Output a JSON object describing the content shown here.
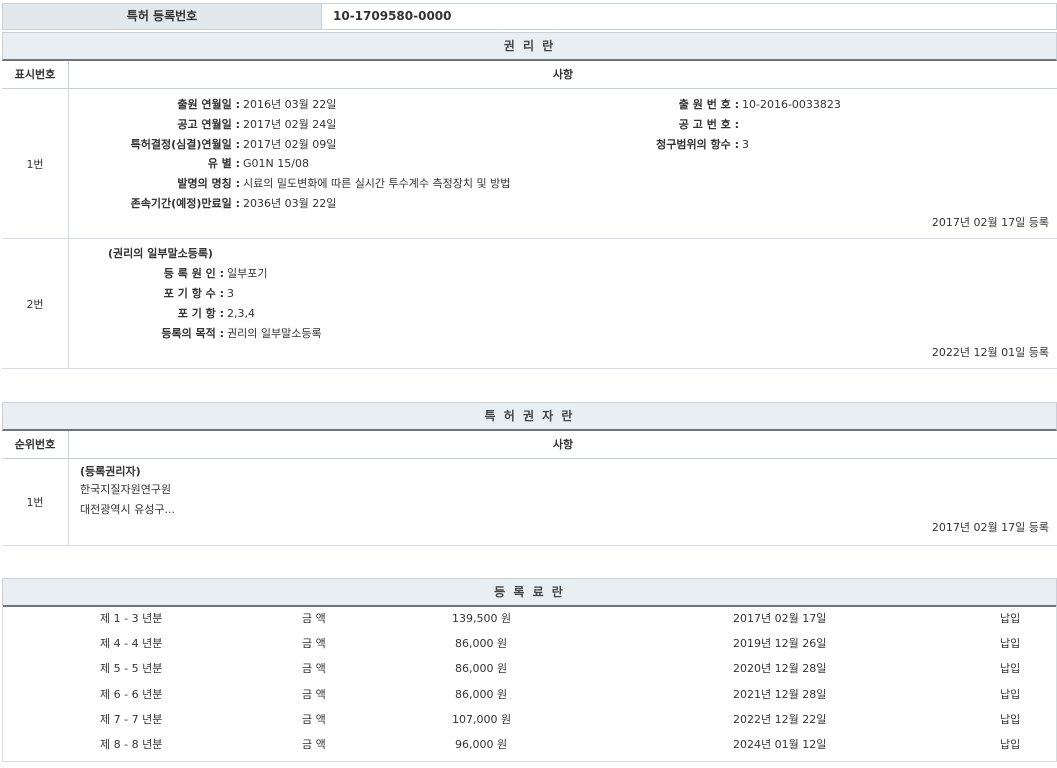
{
  "header": {
    "reg_label": "특허 등록번호",
    "reg_number": "10-1709580-0000"
  },
  "rights": {
    "title": "권 리 란",
    "col_num": "표시번호",
    "col_detail": "사항",
    "entries": [
      {
        "num": "1번",
        "left_fields": [
          {
            "key": "출원 연월일 :",
            "value": "2016년 03월 22일"
          },
          {
            "key": "공고 연월일 :",
            "value": "2017년 02월 24일"
          },
          {
            "key": "특허결정(심결)연월일 :",
            "value": "2017년 02월 09일"
          },
          {
            "key": "유 별 :",
            "value": "G01N 15/08"
          },
          {
            "key": "발명의 명칭 :",
            "value": "시료의 밀도변화에 따른 실시간 투수계수 측정장치 및 방법"
          },
          {
            "key": "존속기간(예정)만료일 :",
            "value": "2036년 03월 22일"
          }
        ],
        "right_fields": [
          {
            "key": "출 원 번 호 :",
            "value": "10-2016-0033823"
          },
          {
            "key": "공 고 번 호 :",
            "value": ""
          },
          {
            "key": "청구범위의 항수 :",
            "value": "3"
          }
        ],
        "date": "2017년 02월 17일 등록"
      },
      {
        "num": "2번",
        "heading": "(권리의 일부말소등록)",
        "fields": [
          {
            "key": "등 록 원 인 :",
            "value": "일부포기"
          },
          {
            "key": "포 기 항 수 :",
            "value": "3"
          },
          {
            "key": "포 기 항 :",
            "value": "2,3,4"
          },
          {
            "key": "등록의 목적 :",
            "value": "권리의 일부말소등록"
          }
        ],
        "date": "2022년 12월 01일 등록"
      }
    ]
  },
  "holders": {
    "title": "특 허 권 자 란",
    "col_num": "순위번호",
    "col_detail": "사항",
    "entries": [
      {
        "num": "1번",
        "heading": "(등록권리자)",
        "name": "한국지질자원연구원",
        "address": "대전광역시 유성구...",
        "date": "2017년 02월 17일 등록"
      }
    ]
  },
  "fees": {
    "title": "등 록 료 란",
    "rows": [
      {
        "period": "제 1 - 3 년분",
        "label": "금 액",
        "amount": "139,500 원",
        "date": "2017년 02월 17일",
        "status": "납입"
      },
      {
        "period": "제 4 - 4 년분",
        "label": "금 액",
        "amount": "86,000 원",
        "date": "2019년 12월 26일",
        "status": "납입"
      },
      {
        "period": "제 5 - 5 년분",
        "label": "금 액",
        "amount": "86,000 원",
        "date": "2020년 12월 28일",
        "status": "납입"
      },
      {
        "period": "제 6 - 6 년분",
        "label": "금 액",
        "amount": "86,000 원",
        "date": "2021년 12월 28일",
        "status": "납입"
      },
      {
        "period": "제 7 - 7 년분",
        "label": "금 액",
        "amount": "107,000 원",
        "date": "2022년 12월 22일",
        "status": "납입"
      },
      {
        "period": "제 8 - 8 년분",
        "label": "금 액",
        "amount": "96,000 원",
        "date": "2024년 01월 12일",
        "status": "납입"
      }
    ]
  }
}
